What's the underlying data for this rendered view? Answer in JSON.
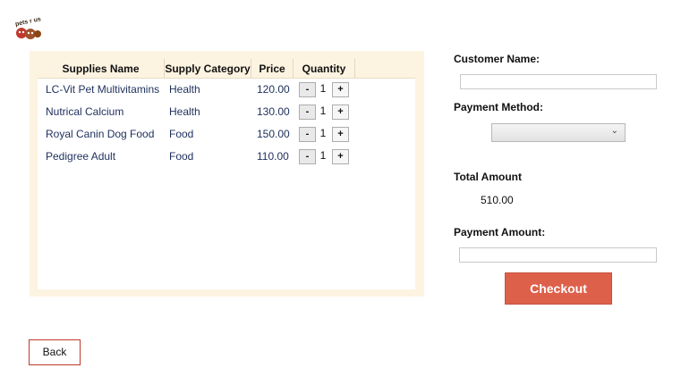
{
  "logo": {
    "icon": "pets-r-us-logo",
    "text": "pets r us"
  },
  "grid": {
    "columns": [
      "Supplies Name",
      "Supply Category",
      "Price",
      "Quantity"
    ],
    "rows": [
      {
        "name": "LC-Vit Pet Multivitamins",
        "category": "Health",
        "price": "120.00",
        "qty": "1"
      },
      {
        "name": "Nutrical Calcium",
        "category": "Health",
        "price": "130.00",
        "qty": "1"
      },
      {
        "name": "Royal Canin Dog Food",
        "category": "Food",
        "price": "150.00",
        "qty": "1"
      },
      {
        "name": "Pedigree Adult",
        "category": "Food",
        "price": "110.00",
        "qty": "1"
      }
    ],
    "minus_label": "-",
    "plus_label": "+"
  },
  "form": {
    "customer_name_label": "Customer Name:",
    "customer_name_value": "",
    "payment_method_label": "Payment Method:",
    "payment_method_value": "",
    "total_amount_label": "Total Amount",
    "total_amount_value": "510.00",
    "payment_amount_label": "Payment Amount:",
    "payment_amount_value": "",
    "checkout_label": "Checkout",
    "back_label": "Back"
  },
  "colors": {
    "accent": "#dd604a",
    "grid_header": "#fdf3e1",
    "text_blue": "#1d2f5c"
  }
}
